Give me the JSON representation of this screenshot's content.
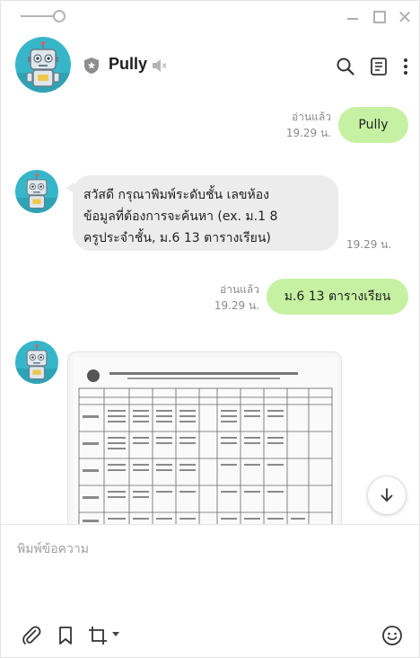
{
  "contact": {
    "name": "Pully"
  },
  "messages": [
    {
      "read_label": "อ่านแล้ว",
      "time": "19.29 น.",
      "text": "Pully"
    },
    {
      "lines": [
        "สวัสดี กรุณาพิมพ์ระดับชั้น เลขห้อง",
        "ข้อมูลที่ต้องการจะค้นหา  (ex. ม.1 8",
        "ครูประจำชั้น, ม.6 13 ตารางเรียน)"
      ],
      "time": "19.29 น."
    },
    {
      "read_label": "อ่านแล้ว",
      "time": "19.29 น.",
      "text": "ม.6 13 ตารางเรียน"
    }
  ],
  "input": {
    "placeholder": "พิมพ์ข้อความ"
  },
  "icons": {
    "pin": "pin-slider-icon",
    "minimize": "minimize-icon",
    "maximize": "maximize-icon",
    "close": "close-icon",
    "shield": "shield-star-icon",
    "mute": "speaker-muted-icon",
    "search": "search-icon",
    "notes": "notes-icon",
    "more": "more-vertical-icon",
    "scroll": "arrow-down-icon",
    "attach": "paperclip-icon",
    "bookmark": "bookmark-icon",
    "crop": "crop-icon",
    "emoji": "emoji-icon"
  },
  "colors": {
    "accent_bubble_out": "#c6f1a3",
    "bubble_in": "#ececec",
    "avatar_bg": "#38b6c9"
  }
}
